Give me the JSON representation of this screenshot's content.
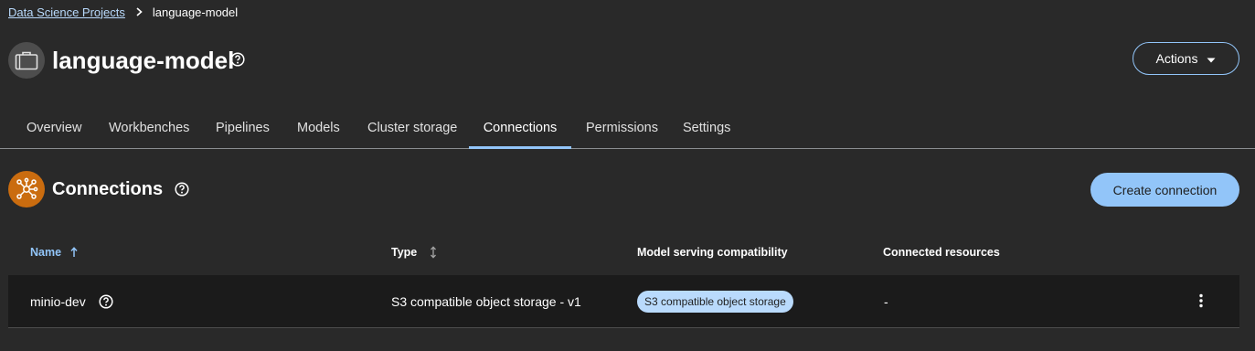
{
  "breadcrumb": {
    "parent": "Data Science Projects",
    "current": "language-model"
  },
  "project": {
    "title": "language-model"
  },
  "actions": {
    "label": "Actions"
  },
  "tabs": [
    {
      "label": "Overview"
    },
    {
      "label": "Workbenches"
    },
    {
      "label": "Pipelines"
    },
    {
      "label": "Models"
    },
    {
      "label": "Cluster storage"
    },
    {
      "label": "Connections"
    },
    {
      "label": "Permissions"
    },
    {
      "label": "Settings"
    }
  ],
  "active_tab": "Connections",
  "section": {
    "title": "Connections",
    "create_label": "Create connection"
  },
  "table": {
    "headers": {
      "name": "Name",
      "type": "Type",
      "compat": "Model serving compatibility",
      "resources": "Connected resources"
    },
    "rows": [
      {
        "name": "minio-dev",
        "type": "S3 compatible object storage - v1",
        "compat": "S3 compatible object storage",
        "resources": "-"
      }
    ]
  },
  "icons": {
    "breadcrumb_separator": "chevron-right-icon",
    "project": "briefcase-icon",
    "help": "question-circle-icon",
    "actions": "caret-down-icon",
    "connections": "connections-network-icon",
    "sort_asc": "arrow-up-icon",
    "sort_unsorted": "arrows-alt-v-icon",
    "row_menu": "kebab-menu-icon"
  },
  "colors": {
    "background": "#292929",
    "accent": "#92c5f9",
    "link": "#b9dafc",
    "connections_icon_bg": "#ca6c0f",
    "row_bg": "#1b1b1b",
    "badge_bg": "#b9dafc"
  }
}
